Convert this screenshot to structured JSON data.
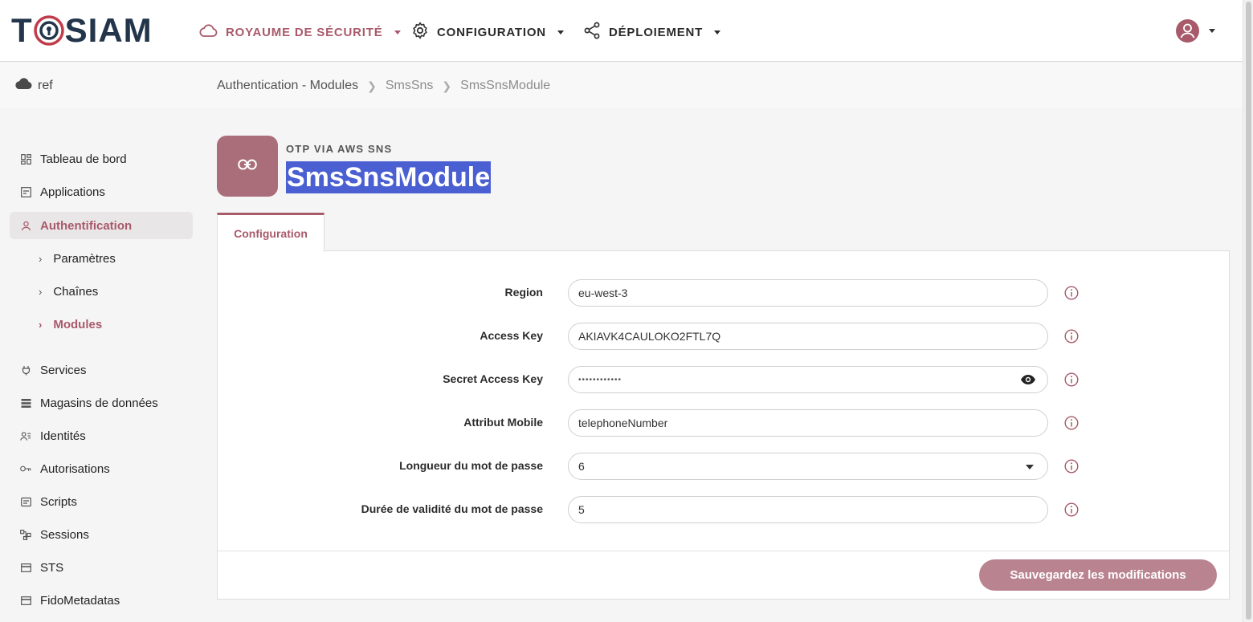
{
  "topbar": {
    "logo_left": "T",
    "logo_right": "SIAM",
    "realm_menu": "ROYAUME DE SÉCURITÉ",
    "config_menu": "CONFIGURATION",
    "deploy_menu": "DÉPLOIEMENT"
  },
  "subheader": {
    "realm": "ref",
    "breadcrumb": [
      "Authentication - Modules",
      "SmsSns",
      "SmsSnsModule"
    ]
  },
  "sidebar": {
    "items": [
      {
        "label": "Tableau de bord",
        "icon": "dashboard-icon"
      },
      {
        "label": "Applications",
        "icon": "applications-icon"
      },
      {
        "label": "Authentification",
        "icon": "user-icon"
      },
      {
        "label": "Paramètres",
        "icon": "chevron-right-icon"
      },
      {
        "label": "Chaînes",
        "icon": "chevron-right-icon"
      },
      {
        "label": "Modules",
        "icon": "chevron-right-icon"
      },
      {
        "label": "Services",
        "icon": "plug-icon"
      },
      {
        "label": "Magasins de données",
        "icon": "list-icon"
      },
      {
        "label": "Identités",
        "icon": "users-icon"
      },
      {
        "label": "Autorisations",
        "icon": "key-icon"
      },
      {
        "label": "Scripts",
        "icon": "script-icon"
      },
      {
        "label": "Sessions",
        "icon": "sessions-icon"
      },
      {
        "label": "STS",
        "icon": "card-icon"
      },
      {
        "label": "FidoMetadatas",
        "icon": "card-icon"
      }
    ]
  },
  "module": {
    "type": "OTP VIA AWS SNS",
    "title": "SmsSnsModule"
  },
  "tabs": [
    {
      "label": "Configuration"
    }
  ],
  "form": {
    "region_label": "Region",
    "region_value": "eu-west-3",
    "access_key_label": "Access Key",
    "access_key_value": "AKIAVK4CAULOKO2FTL7Q",
    "secret_label": "Secret Access Key",
    "secret_value": "••••••••••••",
    "mobile_label": "Attribut Mobile",
    "mobile_value": "telephoneNumber",
    "length_label": "Longueur du mot de passe",
    "length_value": "6",
    "validity_label": "Durée de validité du mot de passe",
    "validity_value": "5"
  },
  "save_label": "Sauvegardez les modifications",
  "colors": {
    "accent": "#a85a6a",
    "module_icon_bg": "#a96e7a",
    "save_button_bg": "#b98390",
    "title_highlight": "#4a5fd1",
    "logo_navy": "#23354a"
  }
}
